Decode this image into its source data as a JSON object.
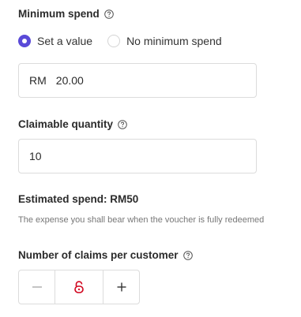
{
  "minimum_spend": {
    "label": "Minimum spend",
    "help_icon": "question-circle-icon",
    "options": [
      {
        "label": "Set a value",
        "checked": true
      },
      {
        "label": "No minimum spend",
        "checked": false
      }
    ],
    "currency_prefix": "RM",
    "value": "20.00"
  },
  "claimable_quantity": {
    "label": "Claimable quantity",
    "help_icon": "question-circle-icon",
    "value": "10"
  },
  "estimated_spend": {
    "text": "Estimated spend: RM50",
    "hint": "The expense you shall bear when the voucher is fully redeemed"
  },
  "claims_per_customer": {
    "label": "Number of claims per customer",
    "help_icon": "question-circle-icon",
    "value": "",
    "overlay_icon": "lock-icon",
    "decrement_icon": "minus-icon",
    "increment_icon": "plus-icon"
  },
  "colors": {
    "accent": "#5a4ad8",
    "lock_icon": "#d0021b",
    "border": "#dcdcdc"
  }
}
